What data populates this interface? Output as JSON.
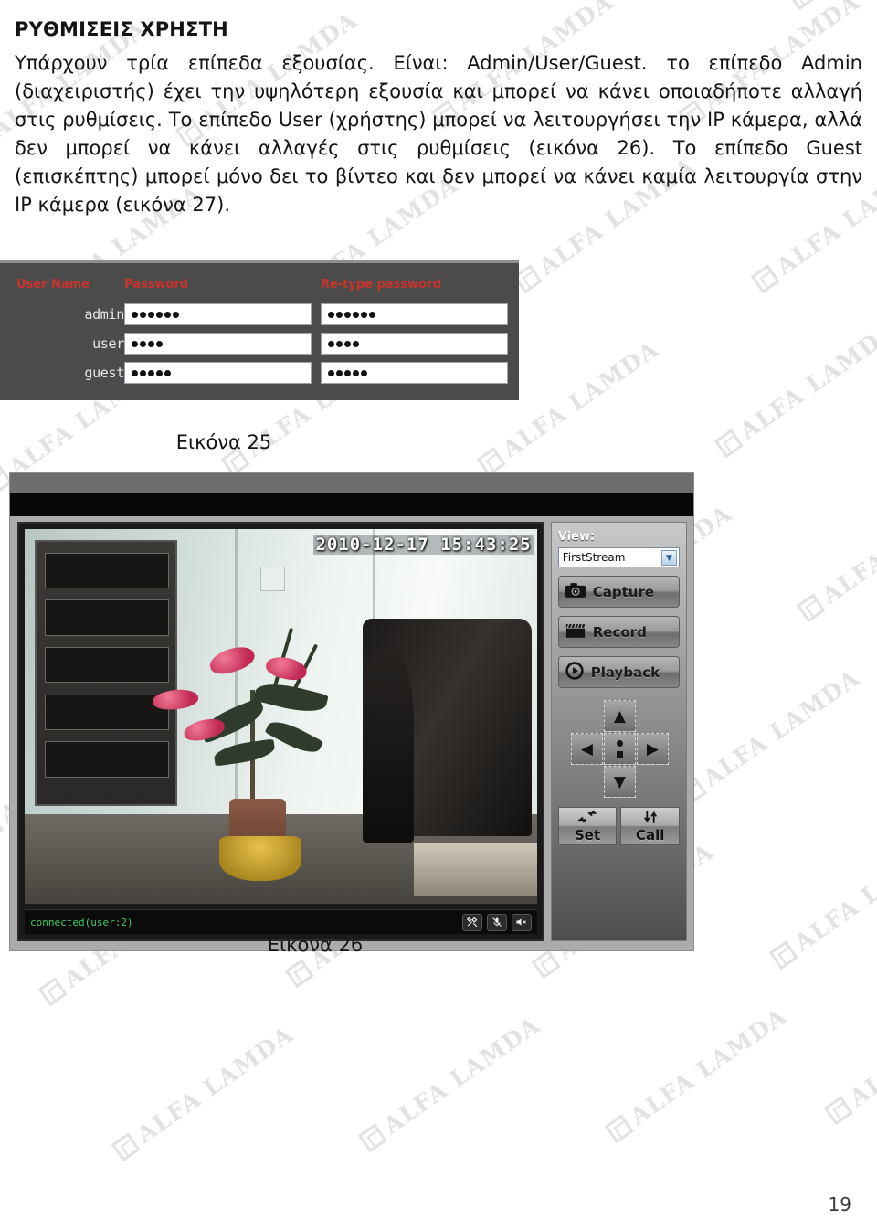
{
  "document": {
    "title": "ΡΥΘΜΙΣΕΙΣ ΧΡΗΣΤΗ",
    "body": "Υπάρχουν τρία επίπεδα εξουσίας. Είναι: Admin/User/Guest. το επίπεδο Admin (διαχειριστής) έχει την υψηλότερη εξουσία και μπορεί να κάνει οποιαδήποτε αλλαγή στις ρυθμίσεις. Το επίπεδο User (χρήστης) μπορεί να λειτουργήσει την IP κάμερα, αλλά δεν μπορεί να κάνει αλλαγές στις ρυθμίσεις (εικόνα 26). Το επίπεδο Guest (επισκέπτης) μπορεί μόνο δει το βίντεο  και δεν μπορεί να κάνει καμία λειτουργία στην IP κάμερα (εικόνα 27).",
    "page_number": "19"
  },
  "watermark": {
    "text": "ALFA LAMDA",
    "color": "#e2e2e2"
  },
  "figure_25": {
    "caption": "Εικόνα 25",
    "header_color": "#c9342c",
    "panel_color": "#4b4b4b",
    "columns": [
      "User Name",
      "Password",
      "Re-type password"
    ],
    "rows": [
      {
        "user_name": "admin",
        "password_dots": 6,
        "retype_dots": 6
      },
      {
        "user_name": "user",
        "password_dots": 4,
        "retype_dots": 4
      },
      {
        "user_name": "guest",
        "password_dots": 5,
        "retype_dots": 5
      }
    ]
  },
  "figure_26": {
    "caption": "Εικόνα 26",
    "video": {
      "timestamp": "2010-12-17 15:43:25",
      "status_text": "connected(user:2)",
      "status_color": "#44c85a",
      "status_icons": [
        "tools-icon",
        "microphone-muted-icon",
        "speaker-muted-icon"
      ]
    },
    "controls": {
      "view_label": "View:",
      "view_selected": "FirstStream",
      "view_options": [
        "FirstStream"
      ],
      "buttons": [
        {
          "label": "Capture",
          "icon": "camera-icon"
        },
        {
          "label": "Record",
          "icon": "clapperboard-icon"
        },
        {
          "label": "Playback",
          "icon": "play-circle-icon"
        }
      ],
      "ptz": {
        "up": "▲",
        "down": "▼",
        "left": "◀",
        "right": "▶",
        "center": "preset-center"
      },
      "preset_buttons": [
        {
          "label": "Set",
          "icon": "horizontal-swap-arrows-icon"
        },
        {
          "label": "Call",
          "icon": "vertical-swap-arrows-icon"
        }
      ]
    }
  }
}
